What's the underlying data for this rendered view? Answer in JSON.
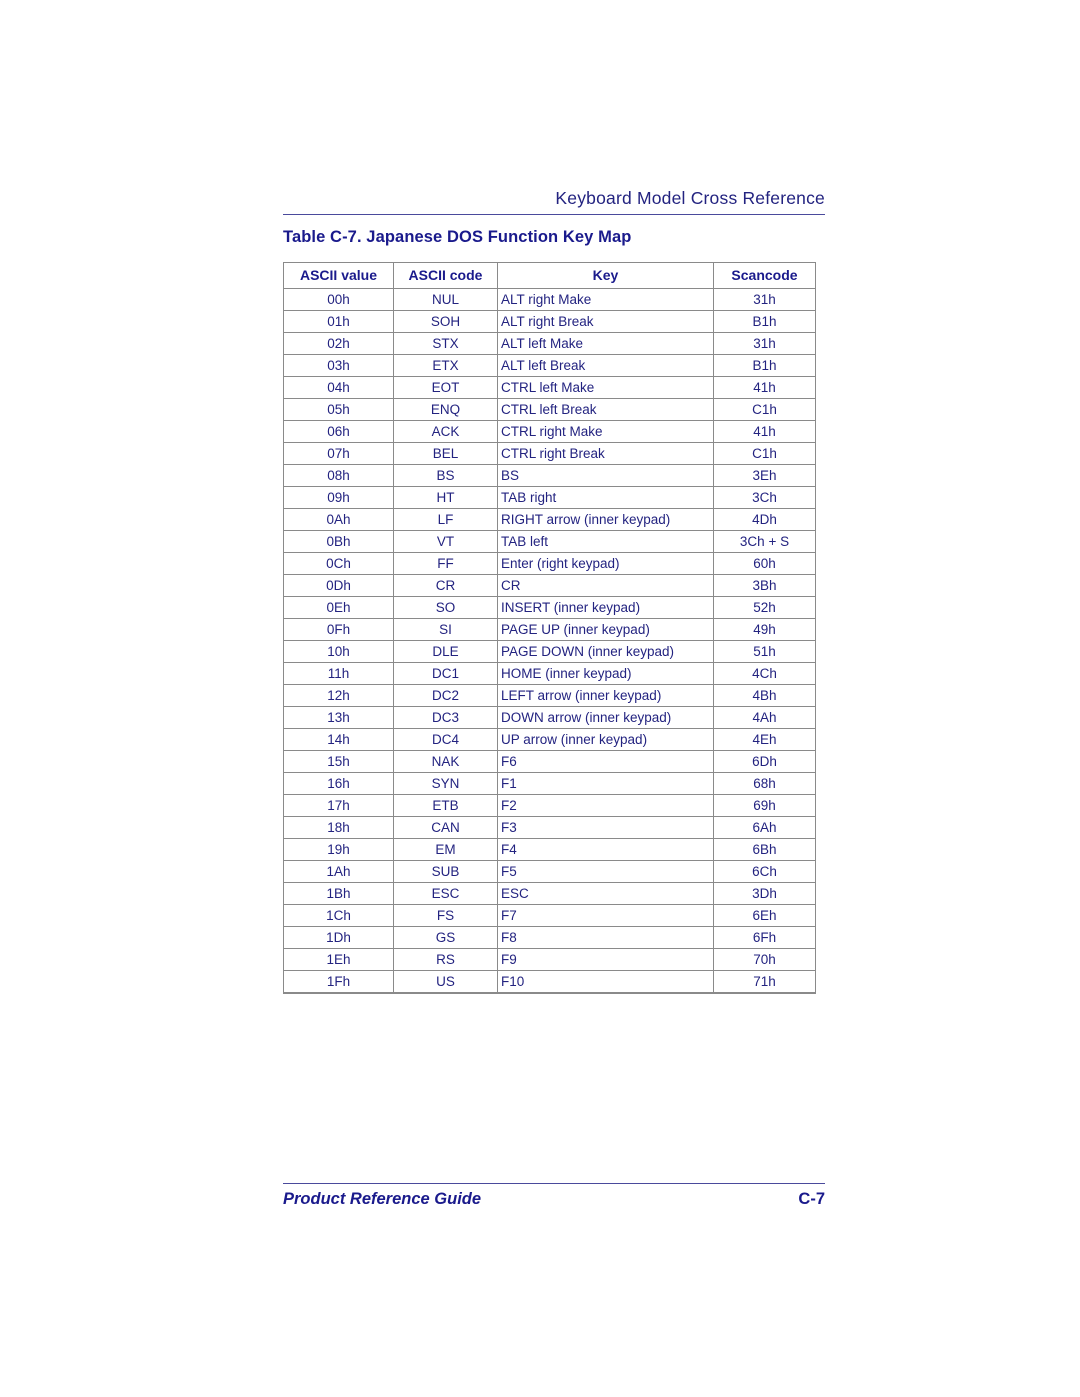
{
  "page": {
    "running_header": "Keyboard Model Cross Reference",
    "caption": "Table C-7. Japanese DOS Function Key Map",
    "footer_title": "Product Reference Guide",
    "footer_page": "C-7",
    "accent_color": "#1a1a8c",
    "rule_color": "#4a4a9c",
    "border_color": "#8a8a8a"
  },
  "table": {
    "columns": [
      "ASCII value",
      "ASCII code",
      "Key",
      "Scancode"
    ],
    "rows": [
      [
        "00h",
        "NUL",
        "ALT right Make",
        "31h"
      ],
      [
        "01h",
        "SOH",
        "ALT right Break",
        "B1h"
      ],
      [
        "02h",
        "STX",
        "ALT left Make",
        "31h"
      ],
      [
        "03h",
        "ETX",
        "ALT left Break",
        "B1h"
      ],
      [
        "04h",
        "EOT",
        "CTRL left Make",
        "41h"
      ],
      [
        "05h",
        "ENQ",
        "CTRL left Break",
        "C1h"
      ],
      [
        "06h",
        "ACK",
        "CTRL right Make",
        "41h"
      ],
      [
        "07h",
        "BEL",
        "CTRL right Break",
        "C1h"
      ],
      [
        "08h",
        "BS",
        "BS",
        "3Eh"
      ],
      [
        "09h",
        "HT",
        "TAB right",
        "3Ch"
      ],
      [
        "0Ah",
        "LF",
        "RIGHT arrow (inner keypad)",
        "4Dh"
      ],
      [
        "0Bh",
        "VT",
        "TAB left",
        "3Ch + S"
      ],
      [
        "0Ch",
        "FF",
        "Enter (right keypad)",
        "60h"
      ],
      [
        "0Dh",
        "CR",
        "CR",
        "3Bh"
      ],
      [
        "0Eh",
        "SO",
        "INSERT (inner keypad)",
        "52h"
      ],
      [
        "0Fh",
        "SI",
        "PAGE UP (inner keypad)",
        "49h"
      ],
      [
        "10h",
        "DLE",
        "PAGE DOWN (inner keypad)",
        "51h"
      ],
      [
        "11h",
        "DC1",
        "HOME (inner keypad)",
        "4Ch"
      ],
      [
        "12h",
        "DC2",
        "LEFT arrow (inner keypad)",
        "4Bh"
      ],
      [
        "13h",
        "DC3",
        "DOWN arrow (inner keypad)",
        "4Ah"
      ],
      [
        "14h",
        "DC4",
        "UP arrow (inner keypad)",
        "4Eh"
      ],
      [
        "15h",
        "NAK",
        "F6",
        "6Dh"
      ],
      [
        "16h",
        "SYN",
        "F1",
        "68h"
      ],
      [
        "17h",
        "ETB",
        "F2",
        "69h"
      ],
      [
        "18h",
        "CAN",
        "F3",
        "6Ah"
      ],
      [
        "19h",
        "EM",
        "F4",
        "6Bh"
      ],
      [
        "1Ah",
        "SUB",
        "F5",
        "6Ch"
      ],
      [
        "1Bh",
        "ESC",
        "ESC",
        "3Dh"
      ],
      [
        "1Ch",
        "FS",
        "F7",
        "6Eh"
      ],
      [
        "1Dh",
        "GS",
        "F8",
        "6Fh"
      ],
      [
        "1Eh",
        "RS",
        "F9",
        "70h"
      ],
      [
        "1Fh",
        "US",
        "F10",
        "71h"
      ]
    ]
  }
}
